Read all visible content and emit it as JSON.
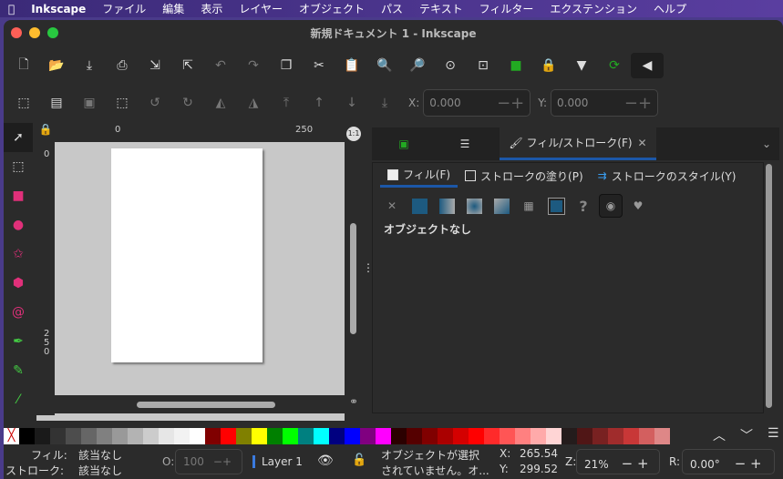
{
  "menubar": {
    "app": "Inkscape",
    "items": [
      "ファイル",
      "編集",
      "表示",
      "レイヤー",
      "オブジェクト",
      "パス",
      "テキスト",
      "フィルター",
      "エクステンション",
      "ヘルプ"
    ]
  },
  "window": {
    "title": "新規ドキュメント 1 - Inkscape"
  },
  "toolbar2": {
    "x_label": "X:",
    "x_value": "0.000",
    "y_label": "Y:",
    "y_value": "0.000"
  },
  "rulers": {
    "h0": "0",
    "h250": "250",
    "v0": "0",
    "v250": "2\n5\n0",
    "zoom_btn": "1:1"
  },
  "panel": {
    "tab_label": "フィル/ストローク(F)",
    "subtabs": [
      "フィル(F)",
      "ストロークの塗り(P)",
      "ストロークのスタイル(Y)"
    ],
    "message": "オブジェクトなし"
  },
  "palette": [
    "#000000",
    "#1a1a1a",
    "#333333",
    "#4d4d4d",
    "#666666",
    "#808080",
    "#999999",
    "#b3b3b3",
    "#cccccc",
    "#e6e6e6",
    "#f2f2f2",
    "#ffffff",
    "#800000",
    "#ff0000",
    "#808000",
    "#ffff00",
    "#008000",
    "#00ff00",
    "#008080",
    "#00ffff",
    "#000080",
    "#0000ff",
    "#800080",
    "#ff00ff",
    "#2b0000",
    "#550000",
    "#800000",
    "#aa0000",
    "#d40000",
    "#ff0000",
    "#ff2a2a",
    "#ff5555",
    "#ff8080",
    "#ffaaaa",
    "#ffd5d5",
    "#241c1c",
    "#501616",
    "#782121",
    "#a02c2c",
    "#c83737",
    "#d35f5f",
    "#de8787"
  ],
  "status": {
    "fill_label": "フィル:",
    "fill_value": "該当なし",
    "stroke_label": "ストローク:",
    "stroke_value": "該当なし",
    "opacity_label": "O:",
    "opacity_value": "100",
    "layer": "Layer 1",
    "message_line1": "オブジェクトが選択",
    "message_line2": "されていません。オ...",
    "x_label": "X:",
    "x_value": "265.54",
    "y_label": "Y:",
    "y_value": "299.52",
    "zoom_label": "Z:",
    "zoom_value": "21%",
    "rotate_label": "R:",
    "rotate_value": "0.00°"
  }
}
